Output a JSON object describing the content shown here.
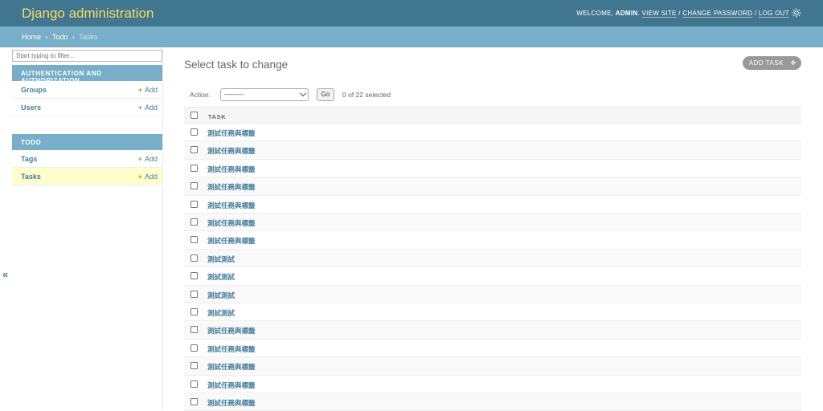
{
  "header": {
    "site_name": "Django administration",
    "welcome": "WELCOME, ",
    "username": "ADMIN",
    "welcome_suffix": ".",
    "view_site": "VIEW SITE",
    "separator": " / ",
    "change_password": "CHANGE PASSWORD",
    "log_out": "LOG OUT",
    "theme_icon": "sun-icon"
  },
  "breadcrumbs": {
    "home": "Home",
    "app": "Todo",
    "current": "Tasks",
    "sep": "›"
  },
  "sidebar": {
    "filter_placeholder": "Start typing to filter...",
    "collapse_glyph": "«",
    "apps": [
      {
        "caption": "AUTHENTICATION AND AUTHORIZATION",
        "models": [
          {
            "name": "Groups",
            "add": "Add"
          },
          {
            "name": "Users",
            "add": "Add"
          }
        ]
      },
      {
        "caption": "TODO",
        "models": [
          {
            "name": "Tags",
            "add": "Add"
          },
          {
            "name": "Tasks",
            "add": "Add",
            "current": true
          }
        ]
      }
    ]
  },
  "content": {
    "title": "Select task to change",
    "add_button": "ADD TASK",
    "action_label": "Action:",
    "action_selected": "---------",
    "go_label": "Go",
    "selected_count": "0 of 22 selected",
    "column_header": "TASK",
    "rows": [
      "測試任務與標籤",
      "測試任務與標籤",
      "測試任務與標籤",
      "測試任務與標籤",
      "測試任務與標籤",
      "測試任務與標籤",
      "測試任務與標籤",
      "測試測試",
      "測試測試",
      "測試測試",
      "測試測試",
      "測試任務與標籤",
      "測試任務與標籤",
      "測試任務與標籤",
      "測試任務與標籤",
      "測試任務與標籤"
    ]
  },
  "colors": {
    "header_bg": "#417690",
    "branding": "#f5dd5d",
    "breadcrumb_bg": "#79aec8",
    "link": "#447e9b",
    "add_plus": "#70bf2b",
    "current_row": "#ffffcc"
  }
}
